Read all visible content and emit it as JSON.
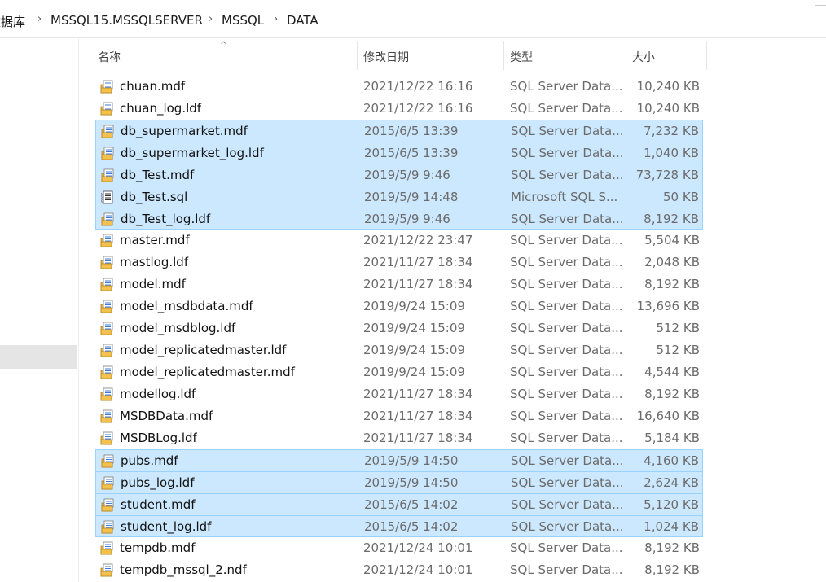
{
  "breadcrumb": {
    "items": [
      "数据库",
      "MSSQL15.MSSQLSERVER",
      "MSSQL",
      "DATA"
    ],
    "separator": "›"
  },
  "columns": {
    "name": "名称",
    "date": "修改日期",
    "type": "类型",
    "size": "大小",
    "sort_indicator": "^"
  },
  "files": [
    {
      "name": "chuan.mdf",
      "date": "2021/12/22 16:16",
      "type": "SQL Server Data...",
      "size": "10,240 KB",
      "icon": "database-file-icon",
      "selected": false
    },
    {
      "name": "chuan_log.ldf",
      "date": "2021/12/22 16:16",
      "type": "SQL Server Data...",
      "size": "10,240 KB",
      "icon": "database-file-icon",
      "selected": false
    },
    {
      "name": "db_supermarket.mdf",
      "date": "2015/6/5 13:39",
      "type": "SQL Server Data...",
      "size": "7,232 KB",
      "icon": "database-file-icon",
      "selected": true
    },
    {
      "name": "db_supermarket_log.ldf",
      "date": "2015/6/5 13:39",
      "type": "SQL Server Data...",
      "size": "1,040 KB",
      "icon": "database-file-icon",
      "selected": true
    },
    {
      "name": "db_Test.mdf",
      "date": "2019/5/9 9:46",
      "type": "SQL Server Data...",
      "size": "73,728 KB",
      "icon": "database-file-icon",
      "selected": true
    },
    {
      "name": "db_Test.sql",
      "date": "2019/5/9 14:48",
      "type": "Microsoft SQL S...",
      "size": "50 KB",
      "icon": "sql-script-icon",
      "selected": true
    },
    {
      "name": "db_Test_log.ldf",
      "date": "2019/5/9 9:46",
      "type": "SQL Server Data...",
      "size": "8,192 KB",
      "icon": "database-file-icon",
      "selected": true
    },
    {
      "name": "master.mdf",
      "date": "2021/12/22 23:47",
      "type": "SQL Server Data...",
      "size": "5,504 KB",
      "icon": "database-file-icon",
      "selected": false
    },
    {
      "name": "mastlog.ldf",
      "date": "2021/11/27 18:34",
      "type": "SQL Server Data...",
      "size": "2,048 KB",
      "icon": "database-file-icon",
      "selected": false
    },
    {
      "name": "model.mdf",
      "date": "2021/11/27 18:34",
      "type": "SQL Server Data...",
      "size": "8,192 KB",
      "icon": "database-file-icon",
      "selected": false
    },
    {
      "name": "model_msdbdata.mdf",
      "date": "2019/9/24 15:09",
      "type": "SQL Server Data...",
      "size": "13,696 KB",
      "icon": "database-file-icon",
      "selected": false
    },
    {
      "name": "model_msdblog.ldf",
      "date": "2019/9/24 15:09",
      "type": "SQL Server Data...",
      "size": "512 KB",
      "icon": "database-file-icon",
      "selected": false
    },
    {
      "name": "model_replicatedmaster.ldf",
      "date": "2019/9/24 15:09",
      "type": "SQL Server Data...",
      "size": "512 KB",
      "icon": "database-file-icon",
      "selected": false
    },
    {
      "name": "model_replicatedmaster.mdf",
      "date": "2019/9/24 15:09",
      "type": "SQL Server Data...",
      "size": "4,544 KB",
      "icon": "database-file-icon",
      "selected": false
    },
    {
      "name": "modellog.ldf",
      "date": "2021/11/27 18:34",
      "type": "SQL Server Data...",
      "size": "8,192 KB",
      "icon": "database-file-icon",
      "selected": false
    },
    {
      "name": "MSDBData.mdf",
      "date": "2021/11/27 18:34",
      "type": "SQL Server Data...",
      "size": "16,640 KB",
      "icon": "database-file-icon",
      "selected": false
    },
    {
      "name": "MSDBLog.ldf",
      "date": "2021/11/27 18:34",
      "type": "SQL Server Data...",
      "size": "5,184 KB",
      "icon": "database-file-icon",
      "selected": false
    },
    {
      "name": "pubs.mdf",
      "date": "2019/5/9 14:50",
      "type": "SQL Server Data...",
      "size": "4,160 KB",
      "icon": "database-file-icon",
      "selected": true
    },
    {
      "name": "pubs_log.ldf",
      "date": "2019/5/9 14:50",
      "type": "SQL Server Data...",
      "size": "2,624 KB",
      "icon": "database-file-icon",
      "selected": true
    },
    {
      "name": "student.mdf",
      "date": "2015/6/5 14:02",
      "type": "SQL Server Data...",
      "size": "5,120 KB",
      "icon": "database-file-icon",
      "selected": true
    },
    {
      "name": "student_log.ldf",
      "date": "2015/6/5 14:02",
      "type": "SQL Server Data...",
      "size": "1,024 KB",
      "icon": "database-file-icon",
      "selected": true
    },
    {
      "name": "tempdb.mdf",
      "date": "2021/12/24 10:01",
      "type": "SQL Server Data...",
      "size": "8,192 KB",
      "icon": "database-file-icon",
      "selected": false
    },
    {
      "name": "tempdb_mssql_2.ndf",
      "date": "2021/12/24 10:01",
      "type": "SQL Server Data...",
      "size": "8,192 KB",
      "icon": "database-file-icon",
      "selected": false
    }
  ],
  "colors": {
    "selection_bg": "#cce8ff",
    "selection_border": "#99d1ff",
    "nav_selected_bg": "#e5e5e5"
  }
}
